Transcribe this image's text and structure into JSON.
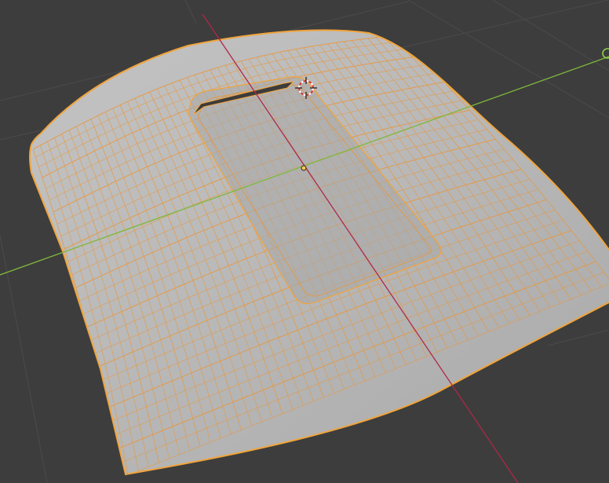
{
  "viewport": {
    "background_color": "#3d3d3d",
    "grid_color": "#4a4a4a",
    "x_axis_color": "#7fb83a",
    "y_axis_color": "#b0284a",
    "mesh_fill_color": "#b6b6b6",
    "mesh_edge_color": "#e9963a",
    "mesh_outline_color": "#f0a43c",
    "origin_color": "#f5c84a",
    "mesh_selected": true,
    "icons": [
      "3d-cursor-icon",
      "object-origin-icon",
      "light-object-icon"
    ]
  }
}
